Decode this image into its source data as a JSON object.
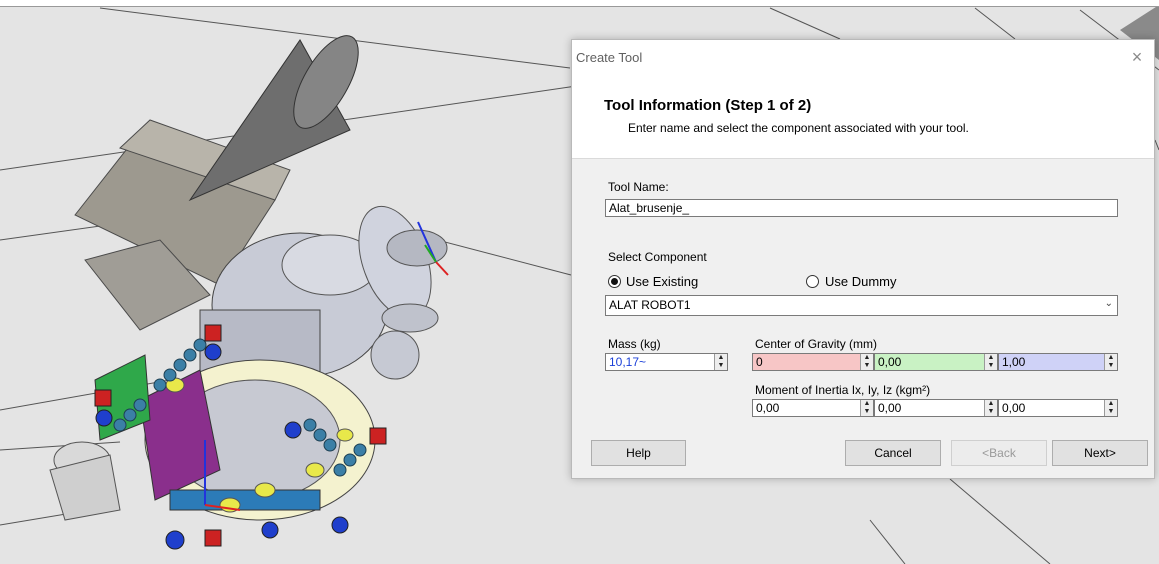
{
  "dialog": {
    "title": "Create Tool",
    "close_glyph": "×",
    "step_title": "Tool Information (Step 1 of 2)",
    "step_subtitle": "Enter name and select the component associated with your tool."
  },
  "form": {
    "tool_name_label": "Tool Name:",
    "tool_name_value": "Alat_brusenje_",
    "select_component_label": "Select Component",
    "use_existing_label": "Use Existing",
    "use_existing_selected": true,
    "use_dummy_label": "Use Dummy",
    "use_dummy_selected": false,
    "component_selected": "ALAT ROBOT1",
    "mass_label": "Mass (kg)",
    "mass_value": "10,17~",
    "cog_label": "Center of Gravity (mm)",
    "cog_values": [
      "0",
      "0,00",
      "1,00"
    ],
    "cog_colors": [
      "#f7c6c6",
      "#c9f2c4",
      "#cfd2f7"
    ],
    "inertia_label": "Moment of Inertia Ix, Iy, Iz (kgm²)",
    "inertia_values": [
      "0,00",
      "0,00",
      "0,00"
    ]
  },
  "buttons": {
    "help": "Help",
    "cancel": "Cancel",
    "back": "<Back",
    "next": "Next>"
  }
}
